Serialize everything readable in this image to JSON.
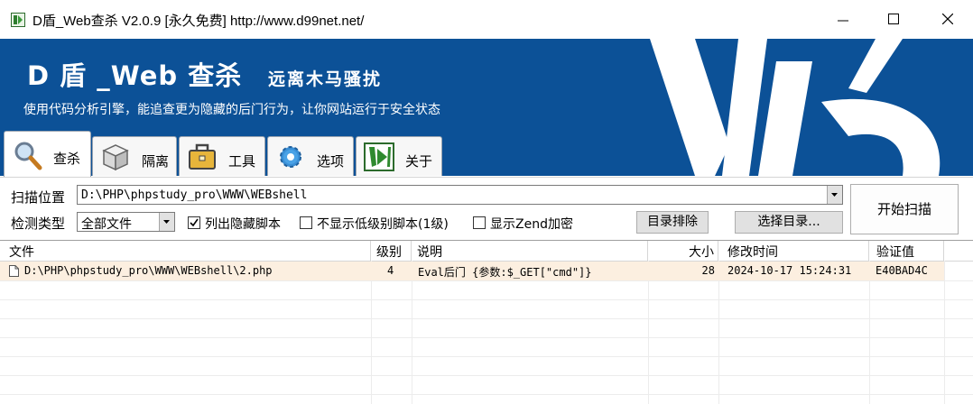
{
  "window": {
    "title": "D盾_Web查杀 V2.0.9 [永久免费] http://www.d99net.net/"
  },
  "banner": {
    "title": "D 盾 _Web 查杀",
    "subtitle": "远离木马骚扰",
    "slogan": "使用代码分析引擎，能追查更为隐藏的后门行为，让你网站运行于安全状态"
  },
  "tabs": [
    {
      "label": "查杀",
      "icon": "magnifier-icon",
      "active": true
    },
    {
      "label": "隔离",
      "icon": "box-icon",
      "active": false
    },
    {
      "label": "工具",
      "icon": "briefcase-icon",
      "active": false
    },
    {
      "label": "选项",
      "icon": "gear-icon",
      "active": false
    },
    {
      "label": "关于",
      "icon": "dshield-logo-icon",
      "active": false
    }
  ],
  "controls": {
    "scan_location_label": "扫描位置",
    "scan_location_value": "D:\\PHP\\phpstudy_pro\\WWW\\WEBshell",
    "detect_type_label": "检测类型",
    "detect_type_value": "全部文件",
    "chk_hidden_label": "列出隐藏脚本",
    "chk_hidden_checked": true,
    "chk_lowlevel_label": "不显示低级别脚本(1级)",
    "chk_lowlevel_checked": false,
    "chk_zend_label": "显示Zend加密",
    "chk_zend_checked": false,
    "exclude_dir_label": "目录排除",
    "select_dir_label": "选择目录...",
    "start_scan_label": "开始扫描"
  },
  "table": {
    "columns": [
      "文件",
      "级别",
      "说明",
      "大小",
      "修改时间",
      "验证值"
    ],
    "rows": [
      {
        "file": "D:\\PHP\\phpstudy_pro\\WWW\\WEBshell\\2.php",
        "level": "4",
        "desc": "Eval后门 {参数:$_GET[\"cmd\"]}",
        "size": "28",
        "mtime": "2024-10-17 15:24:31",
        "hash": "E40BAD4C"
      }
    ]
  },
  "colors": {
    "banner_bg": "#0c5197",
    "row_highlight": "#fcefe0"
  }
}
